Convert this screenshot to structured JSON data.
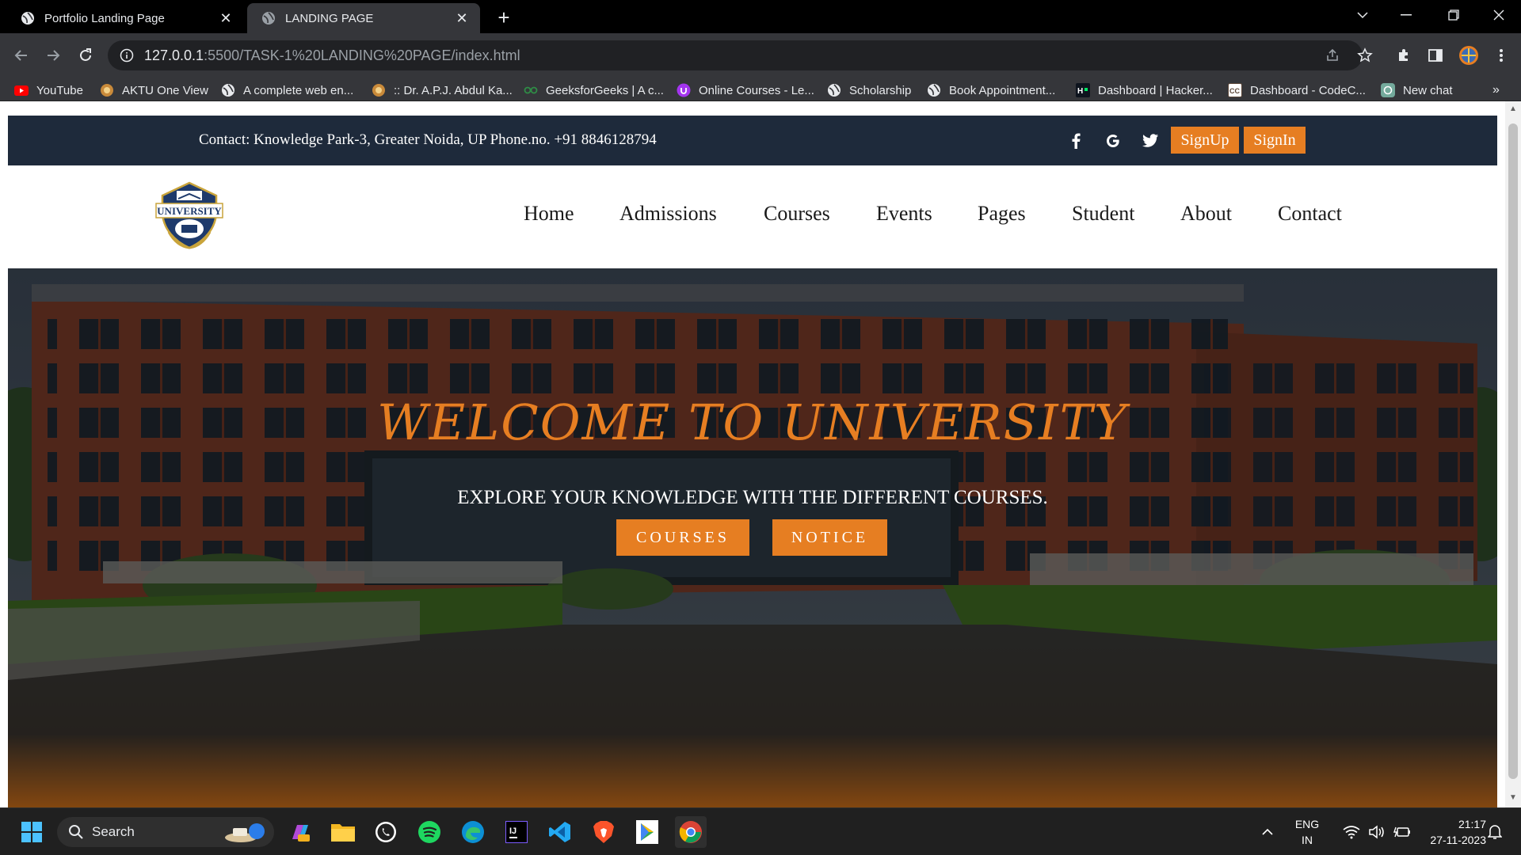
{
  "browser": {
    "tabs": [
      {
        "title": "Portfolio Landing Page",
        "active": false
      },
      {
        "title": "LANDING PAGE",
        "active": true
      }
    ],
    "url_host": "127.0.0.1",
    "url_path": ":5500/TASK-1%20LANDING%20PAGE/index.html",
    "bookmarks": [
      {
        "label": "YouTube",
        "icon": "youtube-icon"
      },
      {
        "label": "AKTU One View",
        "icon": "aktu-icon"
      },
      {
        "label": "A complete web en...",
        "icon": "globe-icon"
      },
      {
        "label": ":: Dr. A.P.J. Abdul Ka...",
        "icon": "aktu-icon"
      },
      {
        "label": "GeeksforGeeks | A c...",
        "icon": "gfg-icon"
      },
      {
        "label": "Online Courses - Le...",
        "icon": "udemy-icon"
      },
      {
        "label": "Scholarship",
        "icon": "globe-icon"
      },
      {
        "label": "Book Appointment...",
        "icon": "globe-icon"
      },
      {
        "label": "Dashboard | Hacker...",
        "icon": "hackerrank-icon"
      },
      {
        "label": "Dashboard - CodeC...",
        "icon": "codechef-icon"
      },
      {
        "label": "New chat",
        "icon": "chatgpt-icon"
      }
    ]
  },
  "site": {
    "contact": "Contact: Knowledge Park-3, Greater Noida, UP Phone.no. +91 8846128794",
    "signup": "SignUp",
    "signin": "SignIn",
    "logo_text": "UNIVERSITY",
    "nav": [
      "Home",
      "Admissions",
      "Courses",
      "Events",
      "Pages",
      "Student",
      "About",
      "Contact"
    ],
    "hero_title": "WELCOME TO UNIVERSITY",
    "hero_subtitle": "EXPLORE YOUR KNOWLEDGE WITH THE DIFFERENT COURSES.",
    "btn_courses": "COURSES",
    "btn_notice": "NOTICE",
    "accent_color": "#e67e22",
    "topbar_color": "#1e2a3b"
  },
  "taskbar": {
    "search_label": "Search",
    "lang_line1": "ENG",
    "lang_line2": "IN",
    "time": "21:17",
    "date": "27-11-2023"
  }
}
